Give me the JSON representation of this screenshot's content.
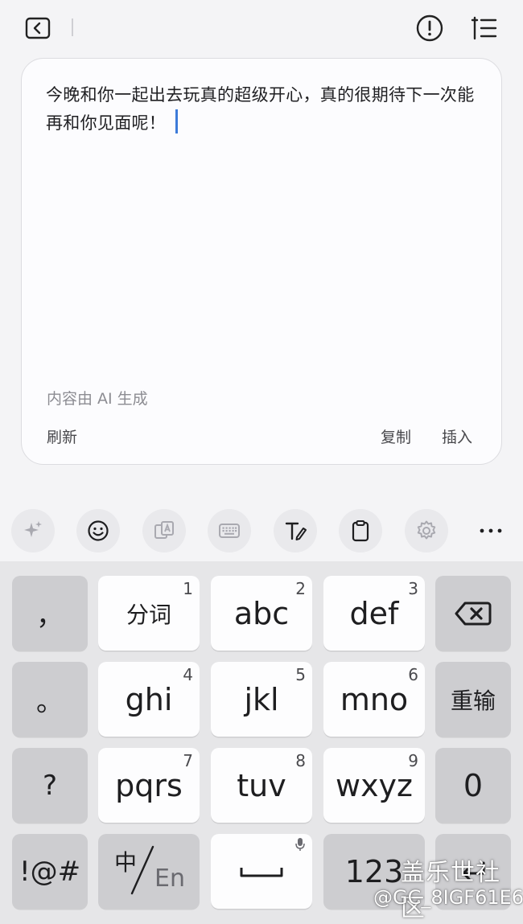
{
  "card": {
    "text": "今晚和你一起出去玩真的超级开心，真的很期待下一次能再和你见面呢！",
    "ai_note": "内容由 AI 生成",
    "refresh": "刷新",
    "copy": "复制",
    "insert": "插入"
  },
  "keyboard": {
    "row1": {
      "comma": "，",
      "k1": "分词",
      "n1": "1",
      "k2": "abc",
      "n2": "2",
      "k3": "def",
      "n3": "3"
    },
    "row2": {
      "period": "。",
      "k4": "ghi",
      "n4": "4",
      "k5": "jkl",
      "n5": "5",
      "k6": "mno",
      "n6": "6",
      "reinput": "重输"
    },
    "row3": {
      "question": "?",
      "k7": "pqrs",
      "n7": "7",
      "k8": "tuv",
      "n8": "8",
      "k9": "wxyz",
      "n9": "9",
      "zero": "0"
    },
    "row4": {
      "symbols": "!@#",
      "lang_cn": "中",
      "lang_en": "En",
      "numbers": "123"
    }
  },
  "watermark": {
    "line1": "盖乐世社区",
    "line2": "@GC_8IGF61E6"
  },
  "colors": {
    "caret": "#3d7bd9",
    "key_light": "#fdfdfe",
    "key_dark": "#cdcdd0"
  }
}
